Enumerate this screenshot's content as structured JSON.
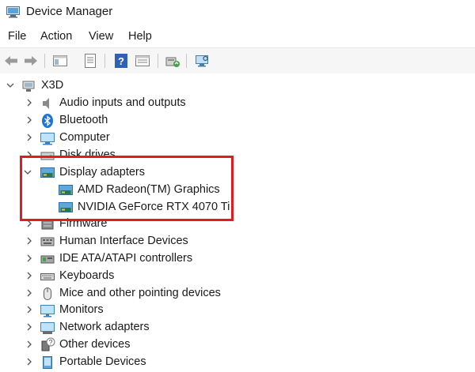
{
  "window": {
    "title": "Device Manager",
    "icon": "device-manager-icon"
  },
  "menu": [
    "File",
    "Action",
    "View",
    "Help"
  ],
  "toolbar": {
    "buttons": [
      "back-arrow-icon",
      "forward-arrow-icon",
      "show-hide-tree-icon",
      "properties-icon",
      "help-icon",
      "view-icon",
      "update-driver-icon",
      "scan-hardware-icon"
    ]
  },
  "tree": {
    "root": {
      "label": "X3D",
      "icon": "computer-root-icon"
    },
    "items": [
      {
        "label": "Audio inputs and outputs",
        "icon": "speaker-icon"
      },
      {
        "label": "Bluetooth",
        "icon": "bluetooth-icon"
      },
      {
        "label": "Computer",
        "icon": "computer-icon"
      },
      {
        "label": "Disk drives",
        "icon": "disk-drive-icon"
      },
      {
        "label": "Display adapters",
        "icon": "display-adapter-icon",
        "expanded": true,
        "children": [
          {
            "label": "AMD Radeon(TM) Graphics",
            "icon": "display-adapter-icon"
          },
          {
            "label": "NVIDIA GeForce RTX 4070 Ti",
            "icon": "display-adapter-icon"
          }
        ]
      },
      {
        "label": "Firmware",
        "icon": "firmware-icon"
      },
      {
        "label": "Human Interface Devices",
        "icon": "hid-icon"
      },
      {
        "label": "IDE ATA/ATAPI controllers",
        "icon": "ide-controller-icon"
      },
      {
        "label": "Keyboards",
        "icon": "keyboard-icon"
      },
      {
        "label": "Mice and other pointing devices",
        "icon": "mouse-icon"
      },
      {
        "label": "Monitors",
        "icon": "monitor-icon"
      },
      {
        "label": "Network adapters",
        "icon": "network-adapter-icon"
      },
      {
        "label": "Other devices",
        "icon": "unknown-device-icon"
      },
      {
        "label": "Portable Devices",
        "icon": "portable-device-icon"
      }
    ]
  },
  "colors": {
    "highlight_border": "#e01b24",
    "toolbar_bg": "#f6f6f6"
  }
}
